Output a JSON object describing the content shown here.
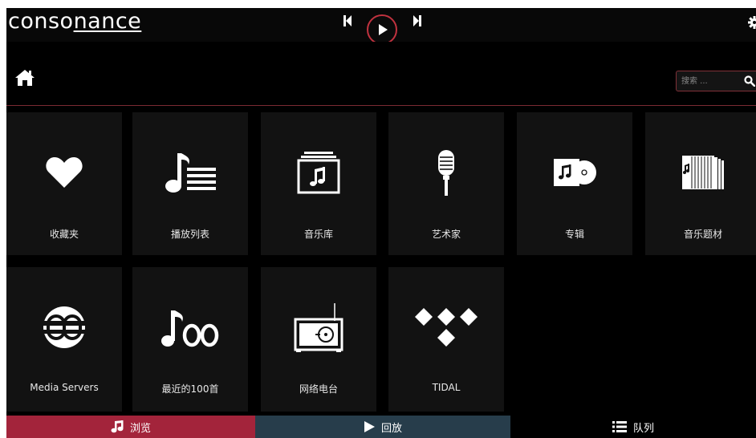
{
  "app": {
    "logo_prefix": "conso",
    "logo_underlined": "nance"
  },
  "player": {
    "prev": "previous-track",
    "play": "play",
    "next": "next-track"
  },
  "search": {
    "placeholder": "搜索 ..."
  },
  "tiles": [
    {
      "label": "收藏夹",
      "icon": "heart-icon"
    },
    {
      "label": "播放列表",
      "icon": "playlist-icon"
    },
    {
      "label": "音乐库",
      "icon": "library-icon"
    },
    {
      "label": "艺术家",
      "icon": "microphone-icon"
    },
    {
      "label": "专辑",
      "icon": "album-icon"
    },
    {
      "label": "音乐题材",
      "icon": "genre-icon"
    },
    {
      "label": "Media Servers",
      "icon": "media-server-icon"
    },
    {
      "label": "最近的100首",
      "icon": "recent-100-icon"
    },
    {
      "label": "网络电台",
      "icon": "radio-icon"
    },
    {
      "label": "TIDAL",
      "icon": "tidal-icon"
    }
  ],
  "bottom_tabs": [
    {
      "label": "浏览",
      "icon": "music-note-icon",
      "color": "#a3243b"
    },
    {
      "label": "回放",
      "icon": "play-icon",
      "color": "#273d4b"
    },
    {
      "label": "队列",
      "icon": "list-icon",
      "color": "#000000"
    }
  ]
}
